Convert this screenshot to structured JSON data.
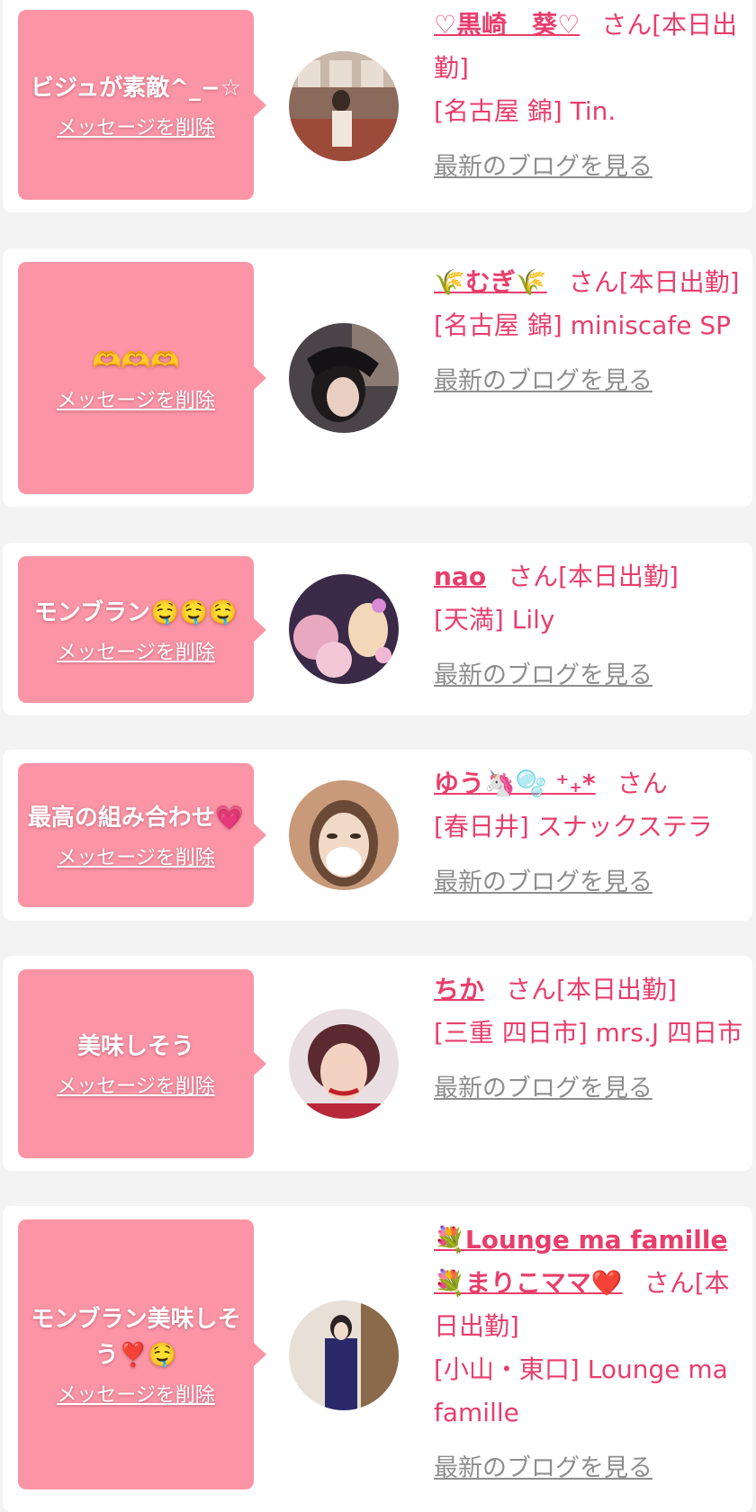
{
  "colors": {
    "page_background": "#f3f3f3",
    "card_background": "#ffffff",
    "bubble_pink": "#fb95a6",
    "accent_text": "#e83e6c",
    "link_gray": "#8e8e8e"
  },
  "items": [
    {
      "message": "ビジュが素敵^_−☆",
      "delete_label": "メッセージを削除",
      "name": "♡黒崎　葵♡",
      "suffix": "さん",
      "status": "[本日出勤]",
      "shop": "[名古屋 錦] Tin.",
      "blog_label": "最新のブログを見る"
    },
    {
      "message": "🫶🫶🫶",
      "delete_label": "メッセージを削除",
      "name": "🌾むぎ🌾",
      "suffix": "さん",
      "status": "[本日出勤]",
      "shop": "[名古屋 錦] miniscafe SP",
      "blog_label": "最新のブログを見る"
    },
    {
      "message": "モンブラン🤤🤤🤤",
      "delete_label": "メッセージを削除",
      "name": "nao",
      "suffix": "さん",
      "status": "[本日出勤]",
      "shop": "[天満] Lily",
      "blog_label": "最新のブログを見る"
    },
    {
      "message": "最高の組み合わせ💗",
      "delete_label": "メッセージを削除",
      "name": "ゆう🦄🫧 ⁺₊*",
      "suffix": "さん",
      "status": "",
      "shop": "[春日井] スナックステラ",
      "blog_label": "最新のブログを見る"
    },
    {
      "message": "美味しそう",
      "delete_label": "メッセージを削除",
      "name": "ちか",
      "suffix": "さん",
      "status": "[本日出勤]",
      "shop": "[三重 四日市] mrs.J 四日市",
      "blog_label": "最新のブログを見る"
    },
    {
      "message": "モンブラン美味しそう❣️🤤",
      "delete_label": "メッセージを削除",
      "name": "💐Lounge ma famille💐まりこママ❤️",
      "suffix": "さん",
      "status": "[本日出勤]",
      "shop": "[小山・東口] Lounge ma famille",
      "blog_label": "最新のブログを見る"
    }
  ]
}
